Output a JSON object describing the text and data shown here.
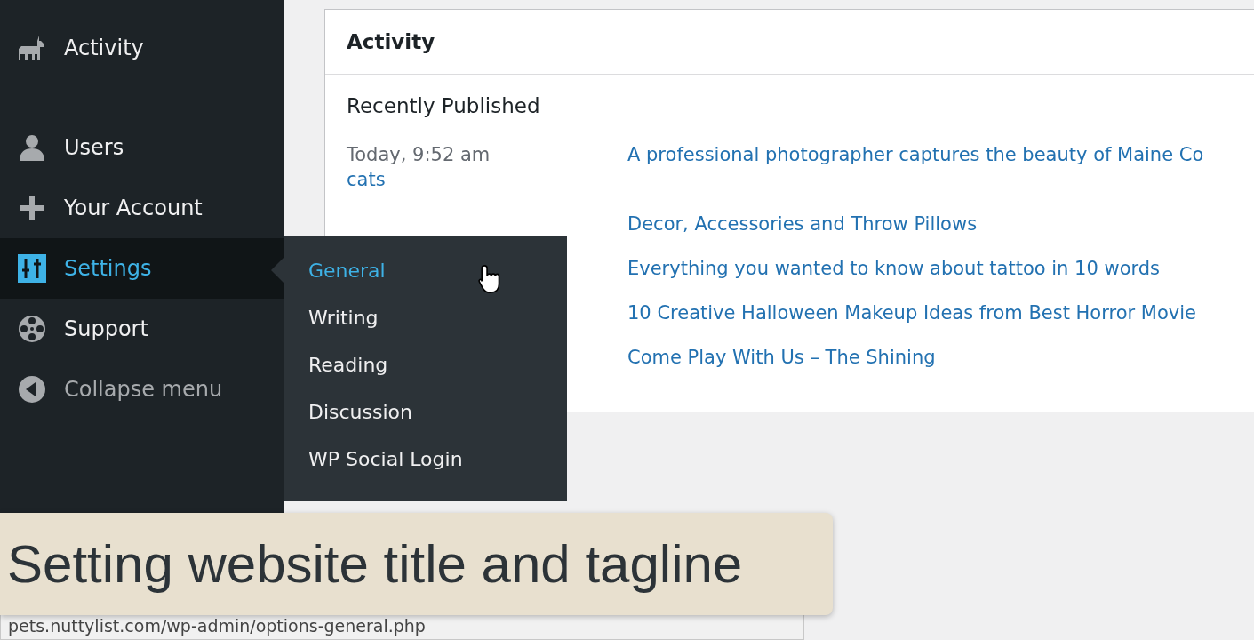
{
  "sidebar": {
    "items": [
      {
        "label": "Activity",
        "kind": "link",
        "selected": false
      },
      {
        "label": "Users",
        "kind": "link",
        "selected": false
      },
      {
        "label": "Your Account",
        "kind": "link",
        "selected": false
      },
      {
        "label": "Settings",
        "kind": "link",
        "selected": true
      },
      {
        "label": "Support",
        "kind": "link",
        "selected": false
      },
      {
        "label": "Collapse menu",
        "kind": "collapse",
        "selected": false
      }
    ]
  },
  "submenu": {
    "items": [
      {
        "label": "General",
        "selected": true
      },
      {
        "label": "Writing",
        "selected": false
      },
      {
        "label": "Reading",
        "selected": false
      },
      {
        "label": "Discussion",
        "selected": false
      },
      {
        "label": "WP Social Login",
        "selected": false
      }
    ]
  },
  "activity_card": {
    "title": "Activity",
    "section": "Recently Published",
    "posts": [
      {
        "date": "Today, 9:52 am",
        "title": "A professional photographer captures the beauty of Maine Co",
        "title_wrap": "cats"
      },
      {
        "title": "Decor, Accessories and Throw Pillows"
      },
      {
        "title": "Everything you wanted to know about tattoo in 10 words"
      },
      {
        "title": "10 Creative Halloween Makeup Ideas from Best Horror Movie"
      },
      {
        "title": "Come Play With Us – The Shining"
      }
    ]
  },
  "caption": "Setting website title and tagline",
  "status_bar": {
    "url": "pets.nuttylist.com/wp-admin/options-general.php"
  }
}
